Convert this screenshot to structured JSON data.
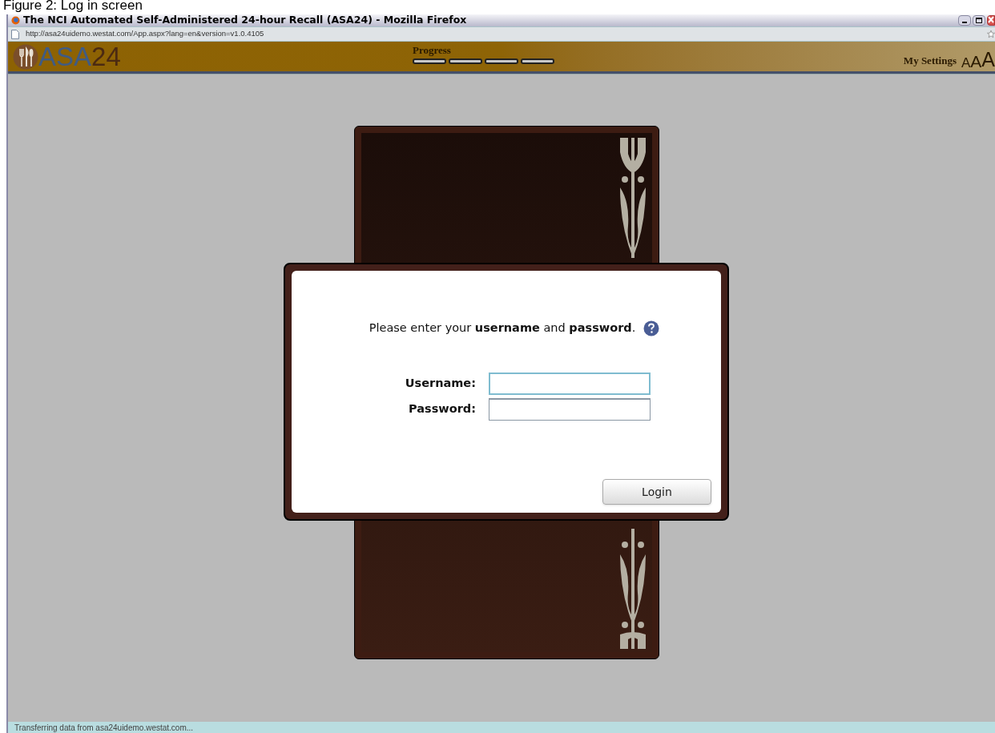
{
  "caption": "Figure 2: Log in screen",
  "window": {
    "title": "The NCI Automated Self-Administered 24-hour Recall (ASA24) - Mozilla Firefox"
  },
  "address_bar": {
    "url": "http://asa24uidemo.westat.com/App.aspx?lang=en&version=v1.0.4105"
  },
  "header": {
    "logo_letters": "ASA",
    "logo_digits": "24",
    "progress_label": "Progress",
    "settings_link": "My Settings",
    "text_sizes": [
      "A",
      "A",
      "A"
    ]
  },
  "login_dialog": {
    "instruction": "Please enter your **username** and **password**.",
    "fields": [
      {
        "label": "Username:",
        "focused": true
      },
      {
        "label": "Password:",
        "focused": false
      }
    ],
    "button": "Login"
  },
  "status_bar": "Transferring data from asa24uidemo.westat.com..."
}
